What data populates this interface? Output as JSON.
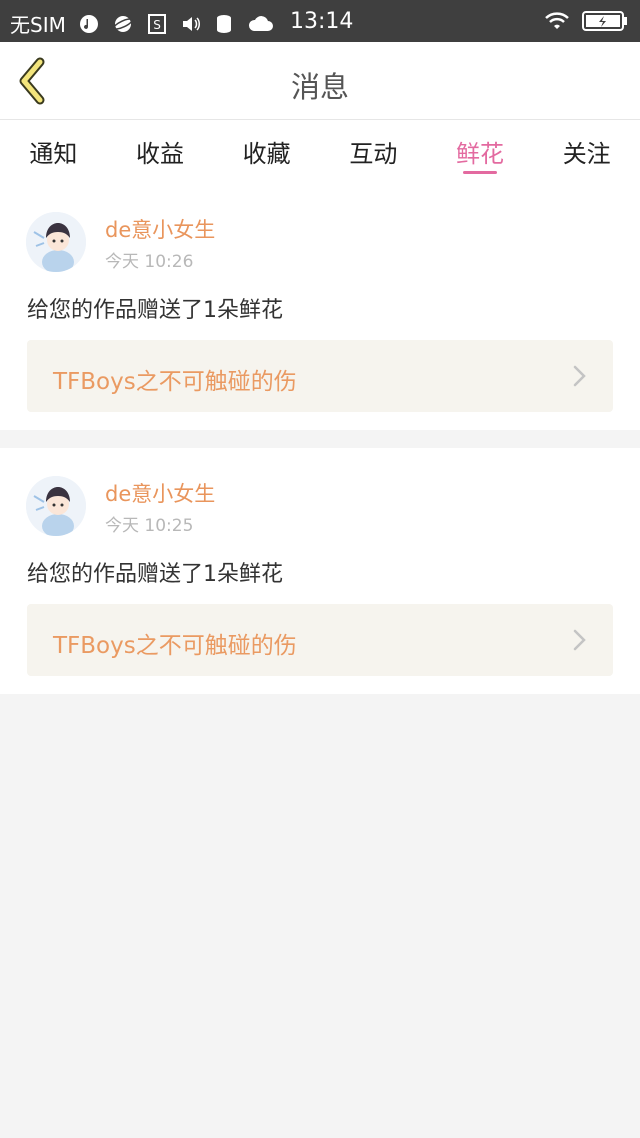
{
  "status_bar": {
    "carrier": "无SIM",
    "time": "13:14"
  },
  "navbar": {
    "title": "消息",
    "back_icon": "chevron-left-icon"
  },
  "tabs": [
    {
      "label": "通知"
    },
    {
      "label": "收益"
    },
    {
      "label": "收藏"
    },
    {
      "label": "互动"
    },
    {
      "label": "鲜花",
      "active": true
    },
    {
      "label": "关注"
    }
  ],
  "messages": [
    {
      "username": "de意小女生",
      "time": "今天 10:26",
      "text": "给您的作品赠送了1朵鲜花",
      "work_title": "TFBoys之不可触碰的伤"
    },
    {
      "username": "de意小女生",
      "time": "今天 10:25",
      "text": "给您的作品赠送了1朵鲜花",
      "work_title": "TFBoys之不可触碰的伤"
    }
  ],
  "colors": {
    "accent": "#e36aa0",
    "username": "#e9955c",
    "statusbar": "#3f3f3f"
  }
}
